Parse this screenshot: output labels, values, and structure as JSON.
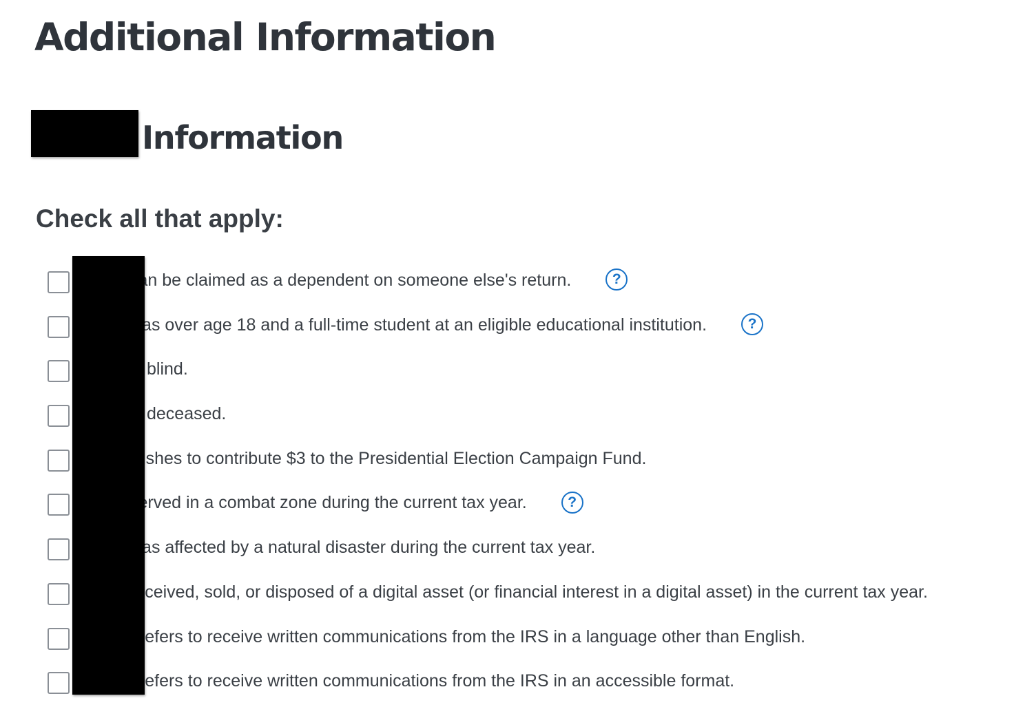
{
  "page": {
    "title": "Additional Information"
  },
  "section": {
    "title": "Information"
  },
  "form": {
    "instruction": "Check all that apply:",
    "options": [
      {
        "label": "can be claimed as a dependent on someone else's return.",
        "has_help": true,
        "checked": false
      },
      {
        "label": "was over age 18 and a full-time student at an eligible educational institution.",
        "has_help": true,
        "checked": false
      },
      {
        "label": "is blind.",
        "has_help": false,
        "checked": false
      },
      {
        "label": "is deceased.",
        "has_help": false,
        "checked": false
      },
      {
        "label": "wishes to contribute $3 to the Presidential Election Campaign Fund.",
        "has_help": false,
        "checked": false
      },
      {
        "label": "served in a combat zone during the current tax year.",
        "has_help": true,
        "checked": false
      },
      {
        "label": "was affected by a natural disaster during the current tax year.",
        "has_help": false,
        "checked": false
      },
      {
        "label": "received, sold, or disposed of a digital asset (or financial interest in a digital asset) in the current tax year.",
        "has_help": false,
        "checked": false
      },
      {
        "label": "prefers to receive written communications from the IRS in a language other than English.",
        "has_help": false,
        "checked": false
      },
      {
        "label": "prefers to receive written communications from the IRS in an accessible format.",
        "has_help": false,
        "checked": false
      }
    ],
    "help_icon_glyph": "?"
  },
  "colors": {
    "heading": "#2f343b",
    "text": "#3a3f45",
    "checkbox_border": "#8a8f96",
    "help_icon": "#1a73c8",
    "redaction": "#000000"
  },
  "icons": {
    "help": "question-circle-icon",
    "checkbox": "checkbox-unchecked-icon"
  }
}
